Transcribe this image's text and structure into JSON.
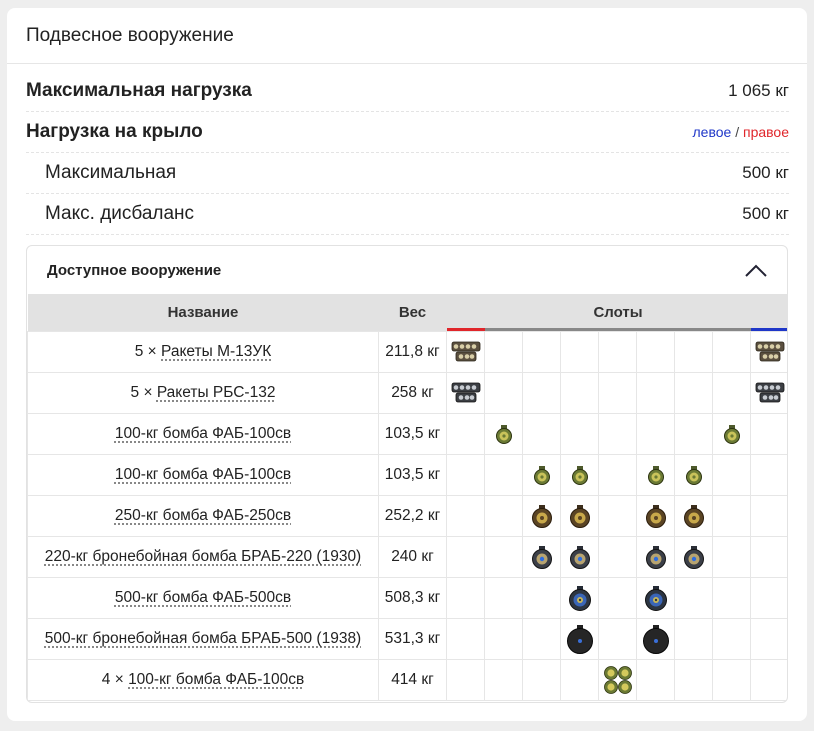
{
  "card": {
    "title": "Подвесное вооружение"
  },
  "stats": {
    "max_load": {
      "label": "Максимальная нагрузка",
      "value": "1 065 кг"
    },
    "wing_load": {
      "label": "Нагрузка на крыло",
      "left": "левое",
      "sep": "/",
      "right": "правое"
    },
    "max": {
      "label": "Максимальная",
      "value": "500 кг"
    },
    "imbalance": {
      "label": "Макс. дисбаланс",
      "value": "500 кг"
    }
  },
  "panel": {
    "title": "Доступное вооружение"
  },
  "table": {
    "headers": {
      "name": "Название",
      "weight": "Вес",
      "slots": "Слоты"
    },
    "rows": [
      {
        "count": "5 × ",
        "name": "Ракеты М-13УК",
        "weight": "211,8 кг",
        "slots": [
          1,
          0,
          0,
          0,
          0,
          0,
          0,
          0,
          1
        ],
        "icon": "rocket-m13-icon"
      },
      {
        "count": "5 × ",
        "name": "Ракеты РБС-132",
        "weight": "258 кг",
        "slots": [
          1,
          0,
          0,
          0,
          0,
          0,
          0,
          0,
          1
        ],
        "icon": "rocket-rbs-icon"
      },
      {
        "count": "",
        "name": "100-кг бомба ФАБ-100св",
        "weight": "103,5 кг",
        "slots": [
          0,
          1,
          0,
          0,
          0,
          0,
          0,
          1,
          0
        ],
        "icon": "bomb-small-icon"
      },
      {
        "count": "",
        "name": "100-кг бомба ФАБ-100св",
        "weight": "103,5 кг",
        "slots": [
          0,
          0,
          1,
          1,
          0,
          1,
          1,
          0,
          0
        ],
        "icon": "bomb-small-icon"
      },
      {
        "count": "",
        "name": "250-кг бомба ФАБ-250св",
        "weight": "252,2 кг",
        "slots": [
          0,
          0,
          1,
          1,
          0,
          1,
          1,
          0,
          0
        ],
        "icon": "bomb-medium-icon"
      },
      {
        "count": "",
        "name": "220-кг бронебойная бомба БРАБ-220 (1930)",
        "weight": "240 кг",
        "slots": [
          0,
          0,
          1,
          1,
          0,
          1,
          1,
          0,
          0
        ],
        "icon": "bomb-ap220-icon"
      },
      {
        "count": "",
        "name": "500-кг бомба ФАБ-500св",
        "weight": "508,3 кг",
        "slots": [
          0,
          0,
          0,
          1,
          0,
          1,
          0,
          0,
          0
        ],
        "icon": "bomb-large-icon"
      },
      {
        "count": "",
        "name": "500-кг бронебойная бомба БРАБ-500 (1938)",
        "weight": "531,3 кг",
        "slots": [
          0,
          0,
          0,
          1,
          0,
          1,
          0,
          0,
          0
        ],
        "icon": "bomb-ap500-icon"
      },
      {
        "count": "4 × ",
        "name": "100-кг бомба ФАБ-100св",
        "weight": "414 кг",
        "slots": [
          0,
          0,
          0,
          0,
          1,
          0,
          0,
          0,
          0
        ],
        "icon": "bomb-cluster-icon"
      }
    ]
  },
  "colors": {
    "left_wing": "#e0262b",
    "center": "#888888",
    "right_wing": "#1f37c8"
  }
}
